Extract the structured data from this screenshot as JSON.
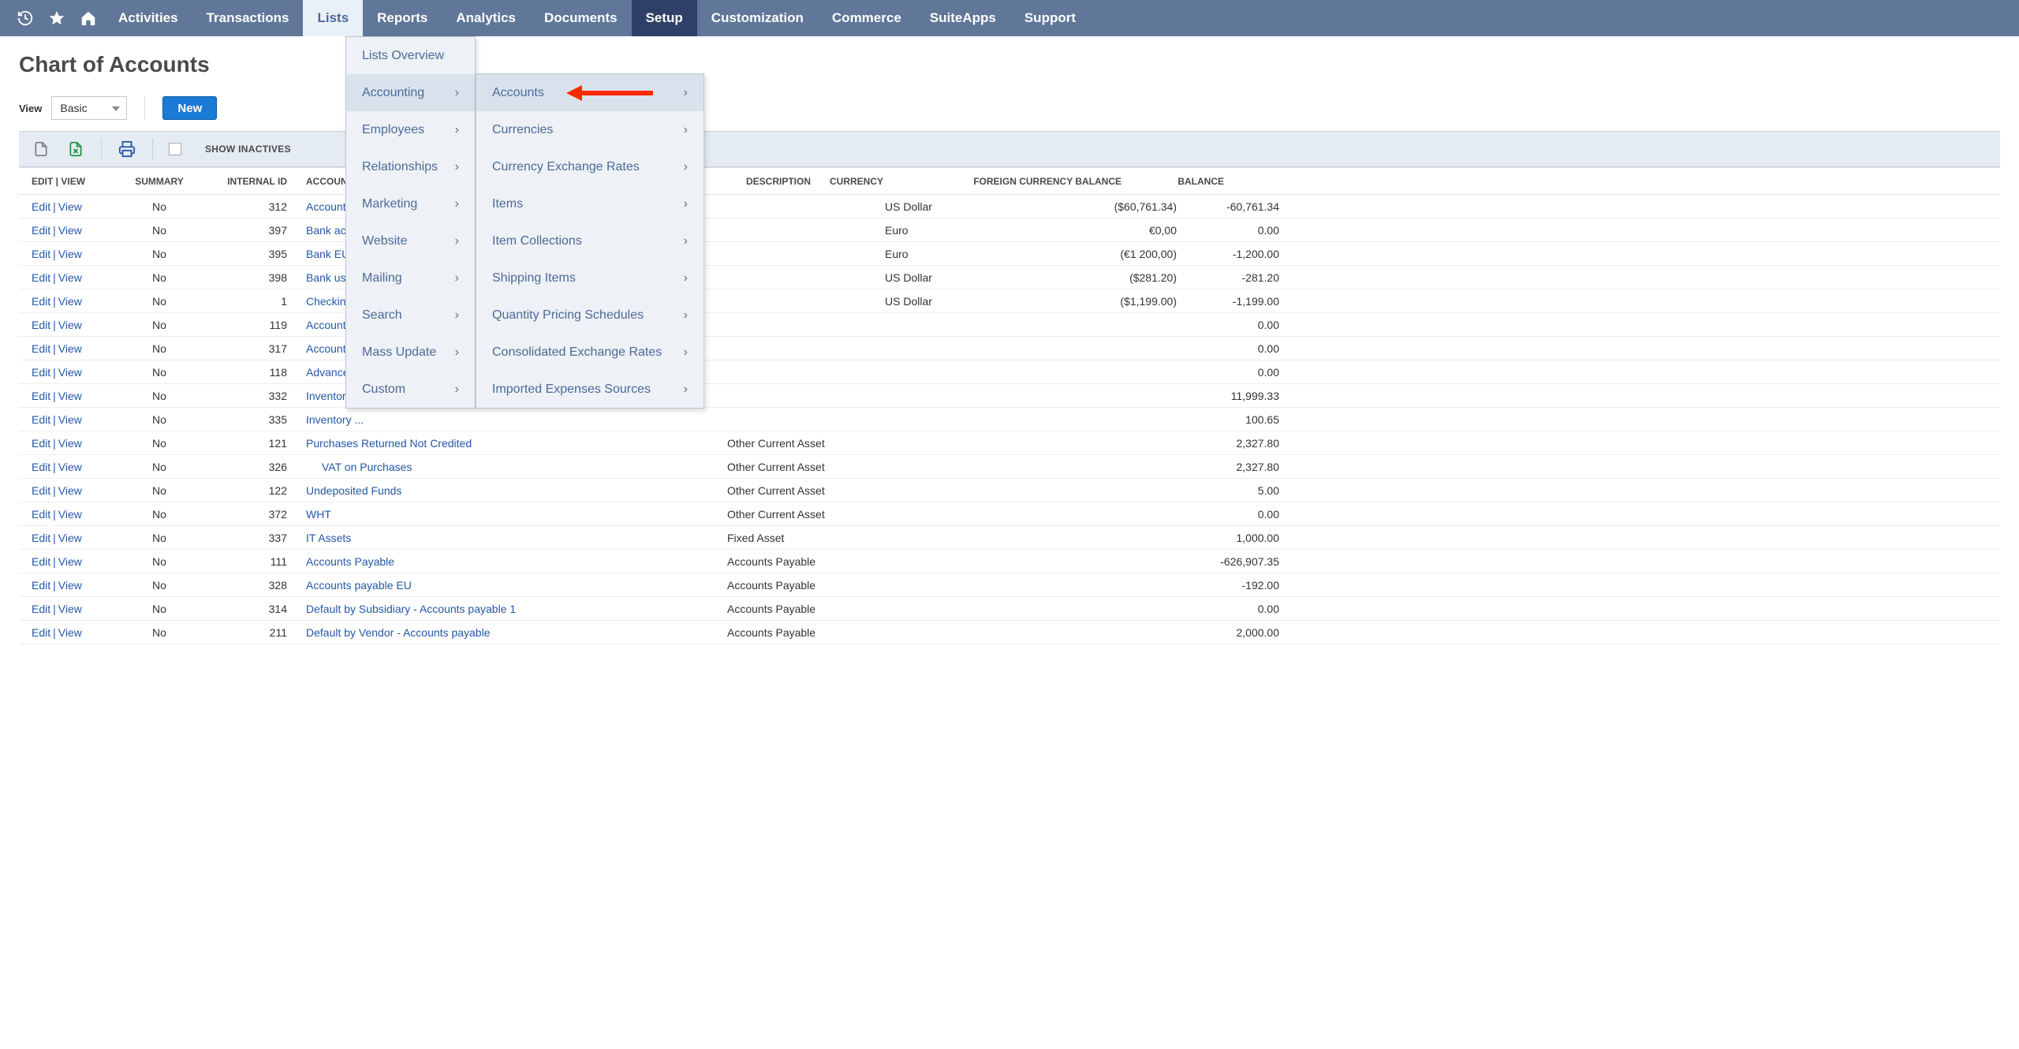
{
  "topnav": {
    "items": [
      {
        "label": "Activities"
      },
      {
        "label": "Transactions"
      },
      {
        "label": "Lists"
      },
      {
        "label": "Reports"
      },
      {
        "label": "Analytics"
      },
      {
        "label": "Documents"
      },
      {
        "label": "Setup"
      },
      {
        "label": "Customization"
      },
      {
        "label": "Commerce"
      },
      {
        "label": "SuiteApps"
      },
      {
        "label": "Support"
      }
    ]
  },
  "page": {
    "title": "Chart of Accounts",
    "view_label": "View",
    "view_value": "Basic",
    "new_button": "New",
    "show_inactives_label": "SHOW INACTIVES"
  },
  "table": {
    "headers": {
      "editview": "EDIT | VIEW",
      "summary": "SUMMARY",
      "internal_id": "INTERNAL ID",
      "account": "ACCOUNT",
      "description": "DESCRIPTION",
      "currency": "CURRENCY",
      "fcb": "FOREIGN CURRENCY BALANCE",
      "balance": "BALANCE"
    },
    "edit_label": "Edit",
    "view_label_cell": "View",
    "rows": [
      {
        "summary": "No",
        "id": "312",
        "account": "Accounts p",
        "account_indent": 0,
        "type": "",
        "currency": "US Dollar",
        "fcb": "($60,761.34)",
        "balance": "-60,761.34"
      },
      {
        "summary": "No",
        "id": "397",
        "account": "Bank acc-t",
        "account_indent": 0,
        "type": "",
        "currency": "Euro",
        "fcb": "€0,00",
        "balance": "0.00"
      },
      {
        "summary": "No",
        "id": "395",
        "account": "Bank EUR",
        "account_indent": 0,
        "type": "",
        "currency": "Euro",
        "fcb": "(€1 200,00)",
        "balance": "-1,200.00"
      },
      {
        "summary": "No",
        "id": "398",
        "account": "Bank usd",
        "account_indent": 0,
        "type": "",
        "currency": "US Dollar",
        "fcb": "($281.20)",
        "balance": "-281.20"
      },
      {
        "summary": "No",
        "id": "1",
        "account": "Checking",
        "account_indent": 0,
        "type": "",
        "currency": "US Dollar",
        "fcb": "($1,199.00)",
        "balance": "-1,199.00"
      },
      {
        "summary": "No",
        "id": "119",
        "account": "Accounts R",
        "account_indent": 0,
        "type": "",
        "currency": "",
        "fcb": "",
        "balance": "0.00"
      },
      {
        "summary": "No",
        "id": "317",
        "account": "Accounts r",
        "account_indent": 0,
        "type": "",
        "currency": "",
        "fcb": "",
        "balance": "0.00"
      },
      {
        "summary": "No",
        "id": "118",
        "account": "Advances",
        "account_indent": 0,
        "type": "",
        "currency": "",
        "fcb": "",
        "balance": "0.00"
      },
      {
        "summary": "No",
        "id": "332",
        "account": "Inventory",
        "account_indent": 0,
        "type": "",
        "currency": "",
        "fcb": "",
        "balance": "11,999.33"
      },
      {
        "summary": "No",
        "id": "335",
        "account": "Inventory ...",
        "account_indent": 0,
        "type": "",
        "currency": "",
        "fcb": "",
        "balance": "100.65"
      },
      {
        "summary": "No",
        "id": "121",
        "account": "Purchases Returned Not Credited",
        "account_indent": 0,
        "type": "Other Current Asset",
        "currency": "",
        "fcb": "",
        "balance": "2,327.80"
      },
      {
        "summary": "No",
        "id": "326",
        "account": "VAT on Purchases",
        "account_indent": 1,
        "type": "Other Current Asset",
        "currency": "",
        "fcb": "",
        "balance": "2,327.80"
      },
      {
        "summary": "No",
        "id": "122",
        "account": "Undeposited Funds",
        "account_indent": 0,
        "type": "Other Current Asset",
        "currency": "",
        "fcb": "",
        "balance": "5.00"
      },
      {
        "summary": "No",
        "id": "372",
        "account": "WHT",
        "account_indent": 0,
        "type": "Other Current Asset",
        "currency": "",
        "fcb": "",
        "balance": "0.00"
      },
      {
        "summary": "No",
        "id": "337",
        "account": "IT Assets",
        "account_indent": 0,
        "type": "Fixed Asset",
        "currency": "",
        "fcb": "",
        "balance": "1,000.00"
      },
      {
        "summary": "No",
        "id": "111",
        "account": "Accounts Payable",
        "account_indent": 0,
        "type": "Accounts Payable",
        "currency": "",
        "fcb": "",
        "balance": "-626,907.35"
      },
      {
        "summary": "No",
        "id": "328",
        "account": "Accounts payable EU",
        "account_indent": 0,
        "type": "Accounts Payable",
        "currency": "",
        "fcb": "",
        "balance": "-192.00"
      },
      {
        "summary": "No",
        "id": "314",
        "account": "Default by Subsidiary - Accounts payable 1",
        "account_indent": 0,
        "type": "Accounts Payable",
        "currency": "",
        "fcb": "",
        "balance": "0.00"
      },
      {
        "summary": "No",
        "id": "211",
        "account": "Default by Vendor - Accounts payable",
        "account_indent": 0,
        "type": "Accounts Payable",
        "currency": "",
        "fcb": "",
        "balance": "2,000.00"
      }
    ]
  },
  "dropdown": {
    "level1": [
      {
        "label": "Lists Overview",
        "chev": false
      },
      {
        "label": "Accounting",
        "chev": true,
        "highlight": true
      },
      {
        "label": "Employees",
        "chev": true
      },
      {
        "label": "Relationships",
        "chev": true
      },
      {
        "label": "Marketing",
        "chev": true
      },
      {
        "label": "Website",
        "chev": true
      },
      {
        "label": "Mailing",
        "chev": true
      },
      {
        "label": "Search",
        "chev": true
      },
      {
        "label": "Mass Update",
        "chev": true
      },
      {
        "label": "Custom",
        "chev": true
      }
    ],
    "level2": [
      {
        "label": "Accounts",
        "chev": true,
        "highlight": true
      },
      {
        "label": "Currencies",
        "chev": true
      },
      {
        "label": "Currency Exchange Rates",
        "chev": true
      },
      {
        "label": "Items",
        "chev": true
      },
      {
        "label": "Item Collections",
        "chev": true
      },
      {
        "label": "Shipping Items",
        "chev": true
      },
      {
        "label": "Quantity Pricing Schedules",
        "chev": true
      },
      {
        "label": "Consolidated Exchange Rates",
        "chev": true
      },
      {
        "label": "Imported Expenses Sources",
        "chev": true
      }
    ]
  }
}
